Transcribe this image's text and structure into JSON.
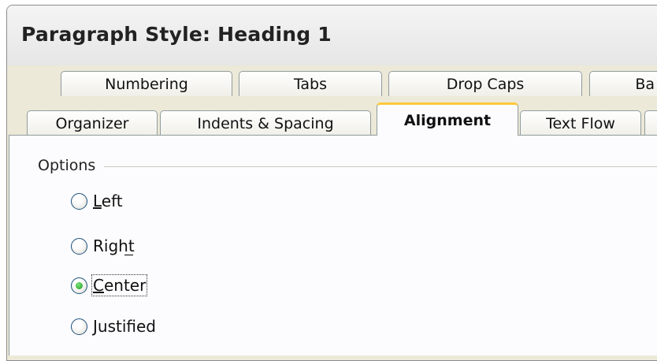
{
  "window": {
    "title": "Paragraph Style: Heading 1"
  },
  "tabs_row1": [
    {
      "label": "Numbering"
    },
    {
      "label": "Tabs"
    },
    {
      "label": "Drop Caps"
    },
    {
      "label": "Ba"
    }
  ],
  "tabs_row2": [
    {
      "label": "Organizer"
    },
    {
      "label": "Indents & Spacing"
    },
    {
      "label": "Alignment",
      "active": true
    },
    {
      "label": "Text Flow"
    }
  ],
  "options": {
    "group_label": "Options",
    "radios": [
      {
        "label": "Left",
        "mnemonic": "L",
        "checked": false
      },
      {
        "label": "Right",
        "mnemonic": "t",
        "checked": false
      },
      {
        "label": "Center",
        "mnemonic": "C",
        "checked": true
      },
      {
        "label": "Justified",
        "mnemonic": "J",
        "checked": false
      }
    ]
  },
  "colors": {
    "active_tab_accent": "#ffc83c",
    "radio_checked": "#1d9a1d"
  }
}
